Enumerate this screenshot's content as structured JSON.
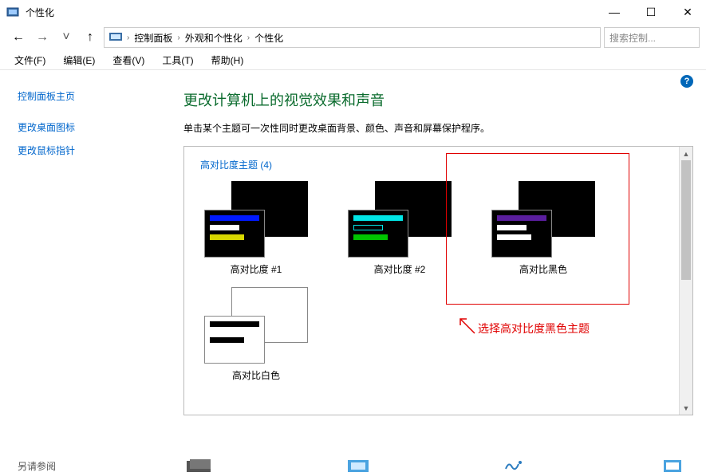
{
  "window": {
    "title": "个性化",
    "controls": {
      "min": "—",
      "max": "☐",
      "close": "✕"
    }
  },
  "nav": {
    "back": "←",
    "forward": "→",
    "recent": "˅",
    "up": "↑",
    "breadcrumbs": [
      "控制面板",
      "外观和个性化",
      "个性化"
    ],
    "search_placeholder": "搜索控制..."
  },
  "menubar": {
    "file": "文件(F)",
    "edit": "编辑(E)",
    "view": "查看(V)",
    "tools": "工具(T)",
    "help": "帮助(H)"
  },
  "sidebar": {
    "home": "控制面板主页",
    "links": [
      "更改桌面图标",
      "更改鼠标指针"
    ],
    "see_also_label": "另请参阅"
  },
  "main": {
    "heading": "更改计算机上的视觉效果和声音",
    "desc": "单击某个主题可一次性同时更改桌面背景、颜色、声音和屏幕保护程序。",
    "section_title": "高对比度主题 (4)",
    "themes": [
      {
        "name": "高对比度 #1",
        "bg": "black",
        "bar1": "#0019ff",
        "bar2": "#d8d800",
        "barText": "#ffffff"
      },
      {
        "name": "高对比度 #2",
        "bg": "black",
        "bar1": "#00e5e5",
        "bar2": "#00c400",
        "barText": "#000000"
      },
      {
        "name": "高对比黑色",
        "bg": "black",
        "bar1": "#5a1e9e",
        "bar2": "#ffffff",
        "barText": "#ffffff"
      },
      {
        "name": "高对比白色",
        "bg": "white",
        "bar1": "#000000",
        "bar2": "#000000",
        "barText": "#ffffff"
      }
    ],
    "callout_text": "选择高对比度黑色主题"
  },
  "help_icon": "?"
}
